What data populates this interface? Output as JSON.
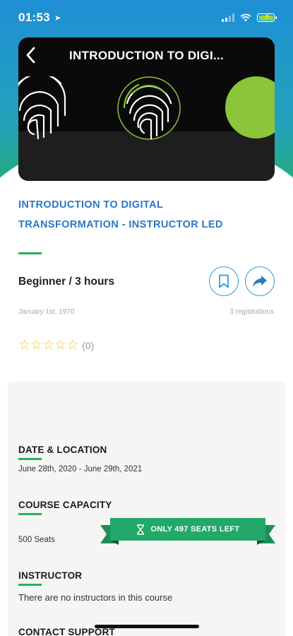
{
  "status_bar": {
    "time": "01:53",
    "location_glyph": "➤"
  },
  "header": {
    "title": "INTRODUCTION TO DIGI...",
    "back_icon": "chevron-left-icon"
  },
  "course": {
    "title": "INTRODUCTION TO DIGITAL TRANSFORMATION - INSTRUCTOR LED",
    "level_duration": "Beginner / 3 hours",
    "date": "January 1st, 1970",
    "registrations": "3 registrations",
    "rating_stars": 5,
    "rating_filled": 0,
    "rating_count": "(0)"
  },
  "sections": {
    "date_location": {
      "heading": "DATE & LOCATION",
      "value": "June 28th, 2020 - June 29th, 2021"
    },
    "capacity": {
      "heading": "COURSE CAPACITY",
      "value": "500 Seats",
      "banner": "ONLY 497 SEATS LEFT"
    },
    "instructor": {
      "heading": "INSTRUCTOR",
      "value": "There are no instructors in this course"
    },
    "contact": {
      "heading": "CONTACT SUPPORT"
    }
  },
  "colors": {
    "accent_blue": "#2a78c2",
    "accent_green": "#27b05a",
    "star": "#f2c21b",
    "ribbon": "#22a868"
  }
}
